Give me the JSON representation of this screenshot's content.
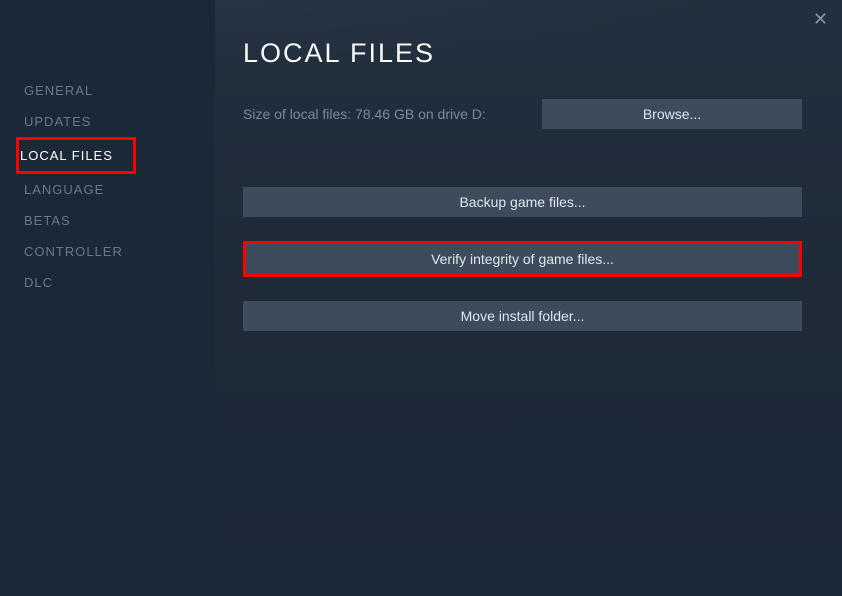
{
  "sidebar": {
    "items": [
      {
        "label": "GENERAL"
      },
      {
        "label": "UPDATES"
      },
      {
        "label": "LOCAL FILES"
      },
      {
        "label": "LANGUAGE"
      },
      {
        "label": "BETAS"
      },
      {
        "label": "CONTROLLER"
      },
      {
        "label": "DLC"
      }
    ]
  },
  "main": {
    "title": "LOCAL FILES",
    "size_info": "Size of local files: 78.46 GB on drive D:",
    "browse_label": "Browse...",
    "backup_label": "Backup game files...",
    "verify_label": "Verify integrity of game files...",
    "move_label": "Move install folder..."
  },
  "close_glyph": "✕"
}
